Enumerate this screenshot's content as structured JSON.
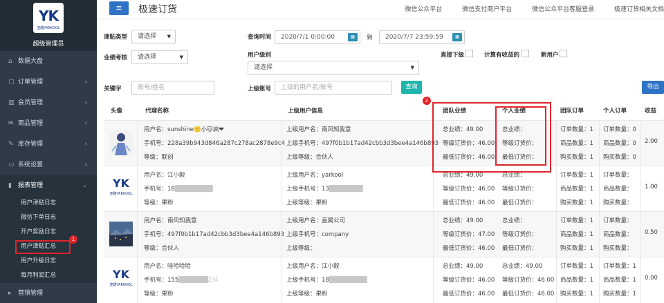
{
  "brand": {
    "logo_text": "YK",
    "logo_sub": "亚酷YARKOOL",
    "name": "超级管理员"
  },
  "sidebar": {
    "items": [
      {
        "icon": "home-icon",
        "glyph": "⌂",
        "label": "数据大盘",
        "has_chevron": false
      },
      {
        "icon": "order-icon",
        "glyph": "▢",
        "label": "订单管理",
        "has_chevron": true
      },
      {
        "icon": "chart-icon",
        "glyph": "▥",
        "label": "会员管理",
        "has_chevron": true
      },
      {
        "icon": "mail-icon",
        "glyph": "✉",
        "label": "商品管理",
        "has_chevron": true
      },
      {
        "icon": "edit-icon",
        "glyph": "✎",
        "label": "库存管理",
        "has_chevron": true
      },
      {
        "icon": "monitor-icon",
        "glyph": "▭",
        "label": "系统设置",
        "has_chevron": true
      },
      {
        "icon": "bar-chart-icon",
        "glyph": "▮",
        "label": "报表管理",
        "has_chevron": true,
        "open": true
      }
    ],
    "sub_items": [
      "用户津贴日志",
      "微信下单日志",
      "开户奖励日志",
      "用户津贴汇总",
      "用户升级日志",
      "每月利润汇总"
    ],
    "active_sub": "用户津贴汇总",
    "bottom_item": "营销管理",
    "badge_1": "1",
    "badge_2": "2"
  },
  "topbar": {
    "title": "极速订货",
    "links": [
      "微信公众平台",
      "微信支付商户平台",
      "微信公众平台客服登录",
      "极速订货相关文档"
    ]
  },
  "filters": {
    "subsidy_type_label": "津贴类型",
    "subsidy_type_value": "请选择",
    "perf_label": "业绩考核",
    "perf_value": "请选择",
    "keyword_label": "关键字",
    "keyword_placeholder": "账号/姓名",
    "time_label": "查询时间",
    "time_from": "2020/7/1 0:00:00",
    "time_to": "2020/7/7 23:59:59",
    "time_to_label": "到",
    "calendar_glyph": "▦",
    "level_label": "用户级别",
    "level_value": "请选择",
    "parent_label": "上级账号",
    "parent_placeholder": "上级的用户名/账号",
    "direct_label": "直接下级",
    "income_label": "计算有收益的",
    "new_user_label": "新用户",
    "query_btn": "查询",
    "export_btn": "导出"
  },
  "table": {
    "headers": [
      "头像",
      "代理名称",
      "上级用户信息",
      "团队业绩",
      "个人业绩",
      "团队订单",
      "个人订单",
      "收益"
    ],
    "rows": [
      {
        "avatar": "anime",
        "name": "用户名：sunshine🙂小🐱启❤",
        "phone": "手机号：228a39b943d846a287c278ac2878e9c4",
        "level": "等级：联创",
        "p_name": "上级用户名：南风知我意",
        "p_phone": "上级手机号：497f0b1b17ad42cbb3d3bee4a146b893",
        "p_level": "上级等级：合伙人",
        "team": [
          "总业绩：49.00",
          "等级订货价：46.00",
          "最低订货价：46.00"
        ],
        "personal": [
          "总业绩：",
          "等级订货价：",
          "最低订货价："
        ],
        "team_orders": [
          "订单数量：1",
          "商品数量：1",
          "购买数量：1"
        ],
        "personal_orders": [
          "订单数量：0",
          "商品数量：0",
          "购买数量：0"
        ],
        "income": "2.00"
      },
      {
        "avatar": "logo",
        "name": "用户名：江小毅",
        "phone": "手机号：18",
        "phone_blur": "█████████",
        "level": "等级：果粉",
        "p_name": "上级用户名：yarkool",
        "p_phone": "上级手机号：13",
        "p_phone_blur": "████████",
        "p_level": "上级等级：果粉",
        "team": [
          "总业绩：49.00",
          "等级订货价：46.00",
          "最低订货价：46.00"
        ],
        "personal": [
          "总业绩：",
          "等级订货价：",
          "最低订货价："
        ],
        "team_orders": [
          "订单数量：1",
          "商品数量：1",
          "购买数量：1"
        ],
        "personal_orders": [
          "订单数量：",
          "商品数量：",
          "购买数量："
        ],
        "income": "1.00"
      },
      {
        "avatar": "landscape",
        "name": "用户名：南风知我意",
        "phone": "手机号：497f0b1b17ad42cbb3d3bee4a146b893",
        "level": "等级：合伙人",
        "p_name": "上级用户名：直属公司",
        "p_phone": "上级手机号：company",
        "p_level": "上级等级：",
        "team": [
          "总业绩：49.00",
          "等级订货价：47.00",
          "最低订货价：46.00"
        ],
        "personal": [
          "总业绩：",
          "等级订货价：",
          "最低订货价："
        ],
        "team_orders": [
          "订单数量：1",
          "商品数量：1",
          "购买数量：1"
        ],
        "personal_orders": [
          "订单数量：",
          "商品数量：",
          "购买数量："
        ],
        "income": "0.50"
      },
      {
        "avatar": "logo",
        "name": "用户名：哇哈哈哈",
        "phone": "手机号：155",
        "phone_blur": "███████234",
        "level": "等级：果粉",
        "p_name": "上级用户名：江小毅",
        "p_phone": "上级手机号：18",
        "p_phone_blur": "█████████",
        "p_level": "上级等级：果粉",
        "team": [
          "总业绩：49.00",
          "等级订货价：46.00",
          "最低订货价：46.00"
        ],
        "personal": [
          "总业绩：49.00",
          "等级订货价：46.00",
          "最低订货价：46.00"
        ],
        "team_orders": [
          "订单数量：1",
          "商品数量：1",
          "购买数量：1"
        ],
        "personal_orders": [
          "订单数量：1",
          "商品数量：1",
          "购买数量：1"
        ],
        "income": "0.00"
      }
    ]
  },
  "colors": {
    "sidebar": "#2f3c48",
    "accent": "#2f73c4",
    "query": "#1fb5ad",
    "highlight": "#e0262b"
  }
}
